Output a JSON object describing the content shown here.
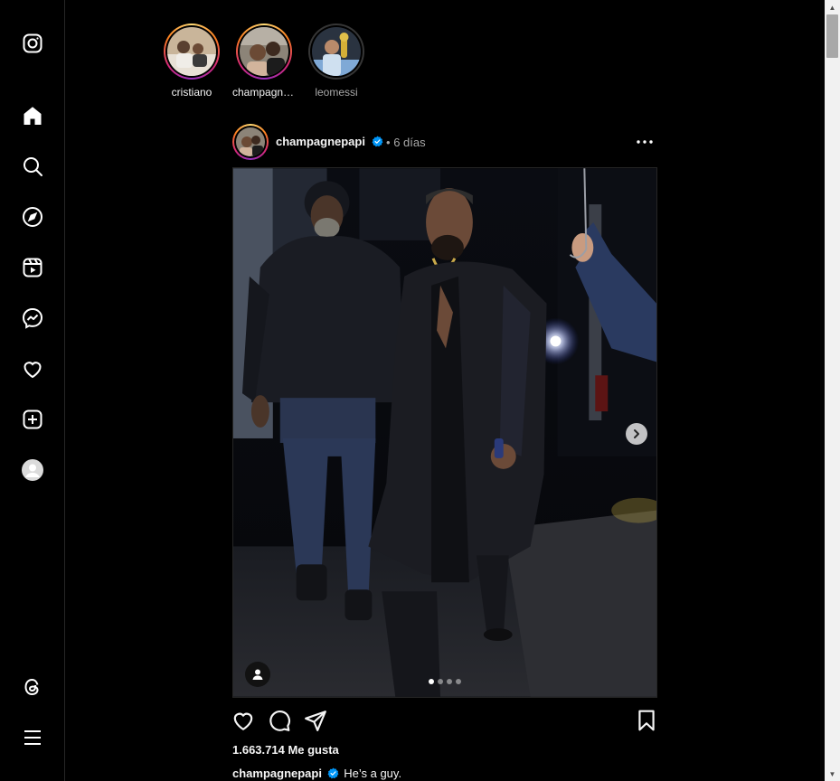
{
  "sidebar": {
    "items": [
      {
        "name": "instagram-logo-icon"
      },
      {
        "name": "home-icon",
        "label": "Inicio"
      },
      {
        "name": "search-icon",
        "label": "Búsqueda"
      },
      {
        "name": "explore-icon",
        "label": "Explorar"
      },
      {
        "name": "reels-icon",
        "label": "Reels"
      },
      {
        "name": "messenger-icon",
        "label": "Mensajes"
      },
      {
        "name": "heart-icon",
        "label": "Notificaciones"
      },
      {
        "name": "create-icon",
        "label": "Crear"
      },
      {
        "name": "profile-avatar",
        "label": "Perfil"
      },
      {
        "name": "threads-icon",
        "label": "Threads"
      },
      {
        "name": "menu-icon",
        "label": "Más"
      }
    ]
  },
  "stories": [
    {
      "username": "cristiano",
      "seen": false
    },
    {
      "username": "champagnepapi",
      "seen": false
    },
    {
      "username": "leomessi",
      "seen": true
    }
  ],
  "post": {
    "username": "champagnepapi",
    "separator": "•",
    "time": "6 días",
    "verified": true,
    "carousel": {
      "current": 1,
      "total": 4
    },
    "likes": "1.663.714 Me gusta",
    "caption_user": "champagnepapi",
    "caption_text": "He’s a guy."
  },
  "colors": {
    "background": "#000000",
    "text": "#f5f5f5",
    "muted": "#a8a8a8",
    "verified": "#0095f6",
    "border": "#262626"
  }
}
